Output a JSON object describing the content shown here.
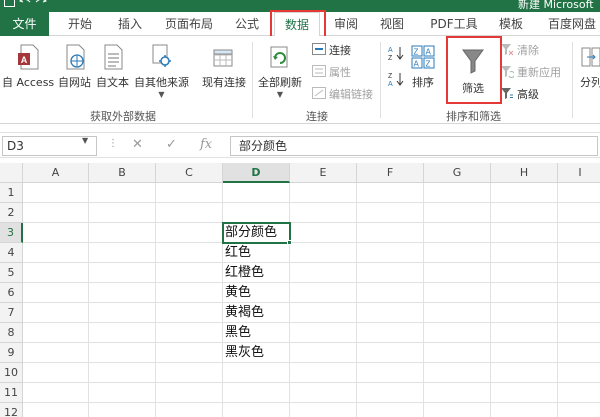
{
  "app": {
    "title": "新建 Microsoft",
    "quick_access": [
      "save-icon",
      "undo-icon",
      "redo-icon"
    ]
  },
  "tabs": [
    {
      "label": "文件"
    },
    {
      "label": "开始"
    },
    {
      "label": "插入"
    },
    {
      "label": "页面布局"
    },
    {
      "label": "公式"
    },
    {
      "label": "数据"
    },
    {
      "label": "审阅"
    },
    {
      "label": "视图"
    },
    {
      "label": "PDF工具"
    },
    {
      "label": "模板"
    },
    {
      "label": "百度网盘"
    }
  ],
  "active_tab": "数据",
  "ribbon": {
    "external": {
      "label": "获取外部数据",
      "buttons": [
        "自 Access",
        "自网站",
        "自文本",
        "自其他来源",
        "现有连接"
      ]
    },
    "connections": {
      "label": "连接",
      "refresh": "全部刷新",
      "connect": "连接",
      "properties": "属性",
      "edit_links": "编辑链接"
    },
    "sort_filter": {
      "label": "排序和筛选",
      "sort": "排序",
      "filter": "筛选",
      "clear": "清除",
      "reapply": "重新应用",
      "advanced": "高级"
    },
    "partial": "分列"
  },
  "formula_bar": {
    "cell_ref": "D3",
    "value": "部分颜色",
    "fx": "fx"
  },
  "grid": {
    "columns": [
      "A",
      "B",
      "C",
      "D",
      "E",
      "F",
      "G",
      "H",
      "I"
    ],
    "rows": [
      "1",
      "2",
      "3",
      "4",
      "5",
      "6",
      "7",
      "8",
      "9",
      "10",
      "11",
      "12"
    ],
    "selected_column": "D",
    "selected_row": "3",
    "column_d_values": [
      "",
      "",
      "部分颜色",
      "红色",
      "红橙色",
      "黄色",
      "黄褐色",
      "黑色",
      "黑灰色",
      "",
      "",
      ""
    ]
  },
  "colors": {
    "excel_green": "#217346",
    "highlight_red": "#e53935"
  }
}
